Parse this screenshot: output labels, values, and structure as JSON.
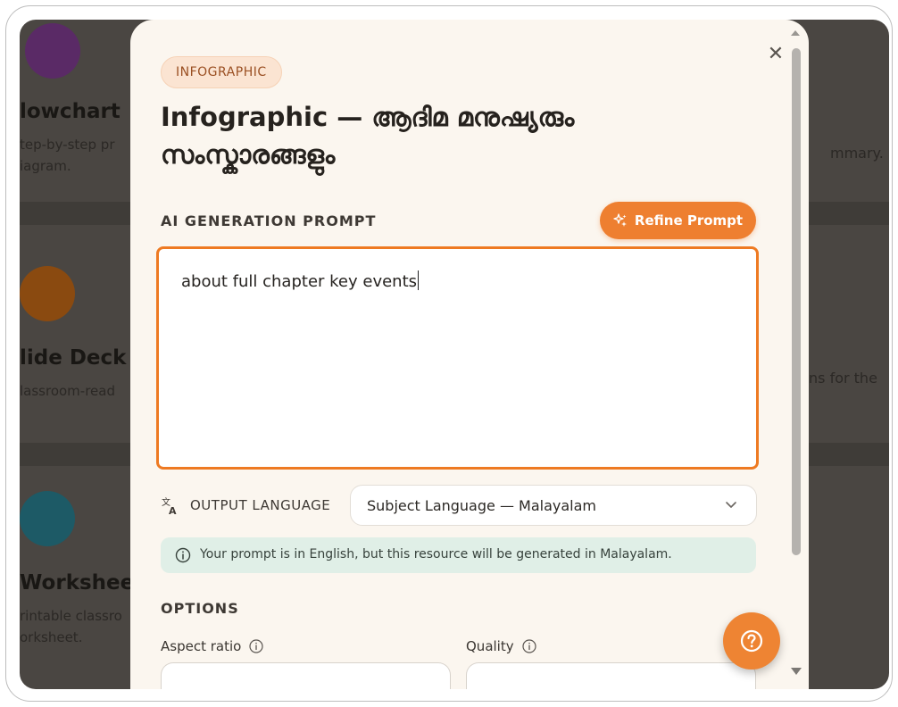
{
  "background": {
    "cards": [
      {
        "title": "lowchart",
        "desc_lines": [
          "tep-by-step pr",
          "iagram."
        ],
        "right_text": "mmary.",
        "color": "#5a2a66"
      },
      {
        "title": "lide Deck",
        "desc_lines": [
          "lassroom-read"
        ],
        "right_text": "ns for the",
        "color": "#8a4a10"
      },
      {
        "title": "Worksheet",
        "desc_lines": [
          "rintable classro",
          "orksheet."
        ],
        "right_text": "",
        "color": "#1d5a66"
      }
    ]
  },
  "modal": {
    "badge": "INFOGRAPHIC",
    "title": "Infographic — ആദിമ മനുഷ്യരും സംസ്കാരങ്ങളും",
    "close_icon": "close-icon",
    "prompt_section_label": "AI GENERATION PROMPT",
    "refine_label": "Refine Prompt",
    "prompt_value": "about full chapter key events",
    "language_label": "OUTPUT LANGUAGE",
    "language_selected": "Subject Language — Malayalam",
    "info_text": "Your prompt is in English, but this resource will be generated in Malayalam.",
    "options_label": "OPTIONS",
    "aspect_ratio_label": "Aspect ratio",
    "quality_label": "Quality"
  },
  "colors": {
    "accent": "#ee7f30",
    "prompt_border": "#ee7a22",
    "modal_bg": "#fbf6ef",
    "info_bg": "#e0efe7"
  }
}
